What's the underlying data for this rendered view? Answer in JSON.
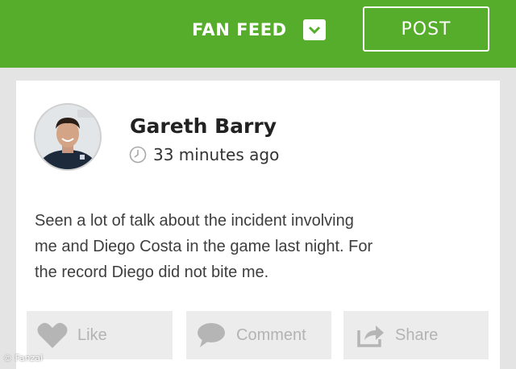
{
  "header": {
    "feed_selector_label": "FAN FEED",
    "post_button_label": "POST",
    "accent_color": "#56ad2b"
  },
  "post": {
    "author": "Gareth Barry",
    "timestamp": "33 minutes ago",
    "body_lines": [
      "Seen a lot of talk about the incident involving",
      "me and Diego Costa in the game last night.  For",
      "the record Diego did not bite me."
    ],
    "avatar_icon": "profile-photo"
  },
  "actions": {
    "like_label": "Like",
    "comment_label": "Comment",
    "share_label": "Share"
  },
  "watermark": {
    "text": "Fanzai"
  }
}
